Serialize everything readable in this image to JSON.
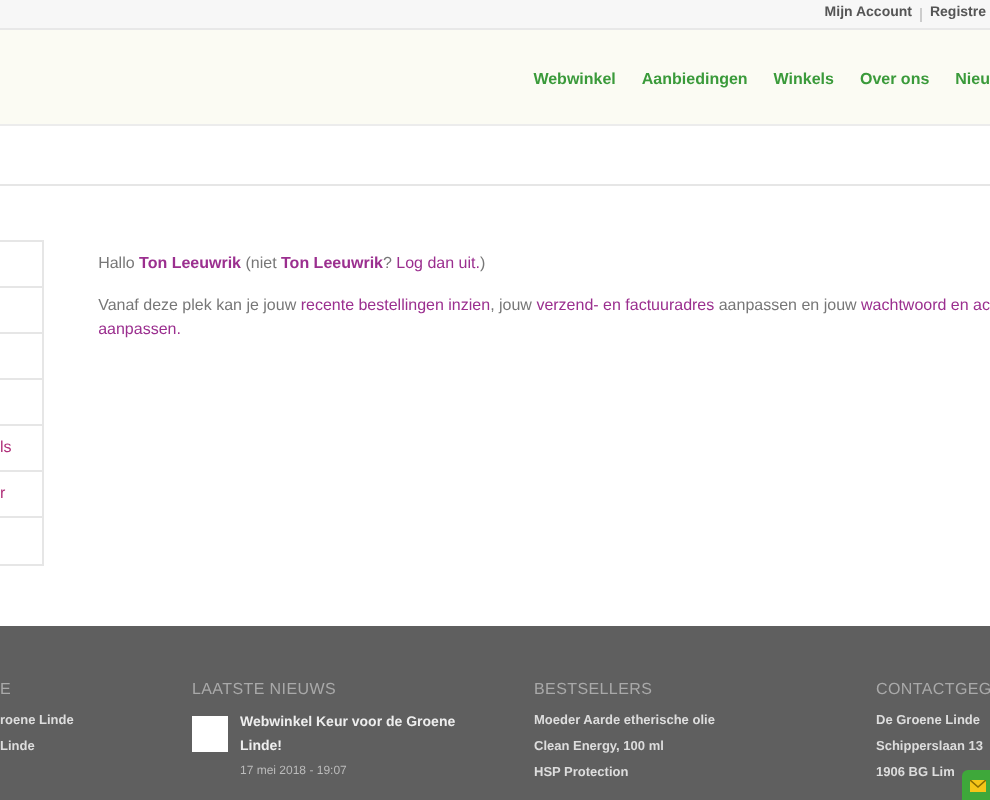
{
  "top_bar": {
    "links": [
      "Mijn Account",
      "Registre"
    ]
  },
  "nav": {
    "items": [
      "Webwinkel",
      "Aanbiedingen",
      "Winkels",
      "Over ons",
      "Nieu"
    ]
  },
  "sidebar": {
    "items": [
      {
        "label": "ls"
      },
      {
        "label": "r"
      }
    ]
  },
  "greeting": [
    {
      "kind": "text",
      "text": "Hallo "
    },
    {
      "kind": "name",
      "text": "Ton Leeuwrik"
    },
    {
      "kind": "text",
      "text": " (niet "
    },
    {
      "kind": "name",
      "text": "Ton Leeuwrik"
    },
    {
      "kind": "text",
      "text": "? "
    },
    {
      "kind": "link",
      "text": "Log dan uit."
    },
    {
      "kind": "text",
      "text": ")"
    }
  ],
  "intro": [
    [
      {
        "kind": "text",
        "text": "Vanaf deze plek kan je jouw "
      },
      {
        "kind": "link",
        "text": "recente bestellingen inzien"
      },
      {
        "kind": "text",
        "text": ", jouw "
      },
      {
        "kind": "link",
        "text": "verzend- en factuuradres"
      },
      {
        "kind": "text",
        "text": " aanpassen en jouw "
      },
      {
        "kind": "link",
        "text": "wachtwoord en ac"
      }
    ],
    [
      {
        "kind": "link",
        "text": "aanpassen."
      }
    ]
  ],
  "footer": {
    "columns": [
      {
        "title": "E",
        "lines": [
          "roene Linde",
          "Linde"
        ]
      },
      {
        "title": "LAATSTE NIEUWS",
        "news": [
          {
            "title": "Webwinkel Keur voor de Groene Linde!",
            "date": "17 mei 2018 - 19:07"
          }
        ]
      },
      {
        "title": "BESTSELLERS",
        "lines": [
          "Moeder Aarde etherische olie",
          "Clean Energy, 100 ml",
          "HSP Protection"
        ]
      },
      {
        "title": "CONTACTGEG",
        "lines": [
          "De Groene Linde",
          "Schipperslaan 13",
          "1906 BG Lim"
        ]
      }
    ]
  }
}
